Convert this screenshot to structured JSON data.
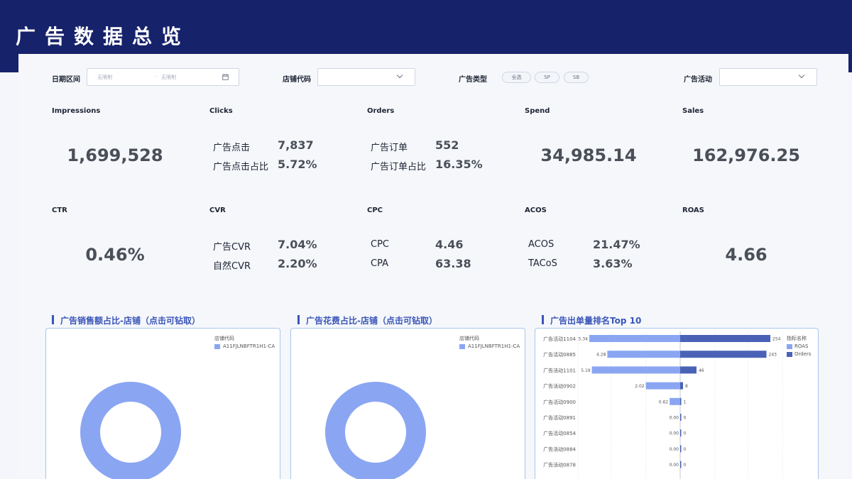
{
  "header": {
    "title": "广告数据总览"
  },
  "filters": {
    "date_label": "日期区间",
    "date_start_placeholder": "无限制",
    "date_end_placeholder": "无限制",
    "date_separator": "-",
    "store_label": "店铺代码",
    "ad_type_label": "广告类型",
    "ad_type_options": [
      "全选",
      "SP",
      "SB"
    ],
    "campaign_label": "广告活动"
  },
  "kpis": {
    "impressions": {
      "title": "Impressions",
      "value": "1,699,528"
    },
    "clicks": {
      "title": "Clicks",
      "rows": [
        {
          "label": "广告点击",
          "value": "7,837"
        },
        {
          "label": "广告点击占比",
          "value": "5.72%"
        }
      ]
    },
    "orders": {
      "title": "Orders",
      "rows": [
        {
          "label": "广告订单",
          "value": "552"
        },
        {
          "label": "广告订单占比",
          "value": "16.35%"
        }
      ]
    },
    "spend": {
      "title": "Spend",
      "value": "34,985.14"
    },
    "sales": {
      "title": "Sales",
      "value": "162,976.25"
    },
    "ctr": {
      "title": "CTR",
      "value": "0.46%"
    },
    "cvr": {
      "title": "CVR",
      "rows": [
        {
          "label": "广告CVR",
          "value": "7.04%"
        },
        {
          "label": "自然CVR",
          "value": "2.20%"
        }
      ]
    },
    "cpc": {
      "title": "CPC",
      "rows": [
        {
          "label": "CPC",
          "value": "4.46"
        },
        {
          "label": "CPA",
          "value": "63.38"
        }
      ]
    },
    "acos": {
      "title": "ACOS",
      "rows": [
        {
          "label": "ACOS",
          "value": "21.47%"
        },
        {
          "label": "TACoS",
          "value": "3.63%"
        }
      ]
    },
    "roas": {
      "title": "ROAS",
      "value": "4.66"
    }
  },
  "sections": {
    "sales_share": {
      "title": "广告销售额占比-店铺（点击可钻取）",
      "legend_title": "店铺代码",
      "legend_item": "A11FJLNBFTR1H1-CA"
    },
    "spend_share": {
      "title": "广告花费占比-店铺（点击可钻取）",
      "legend_title": "店铺代码",
      "legend_item": "A11FJLNBFTR1H1-CA"
    },
    "top10": {
      "title": "广告出单量排名Top 10",
      "legend_title": "指标名称",
      "legend_items": [
        "ROAS",
        "Orders"
      ]
    }
  },
  "colors": {
    "header": "#16226a",
    "roas": "#8aa6f2",
    "orders": "#4a62b6",
    "accent": "#3a55b8"
  },
  "chart_data": [
    {
      "type": "pie",
      "categories": [
        "A11FJLNBFTR1H1-CA"
      ],
      "values": [
        100
      ]
    },
    {
      "type": "pie",
      "categories": [
        "A11FJLNBFTR1H1-CA"
      ],
      "values": [
        100
      ]
    },
    {
      "type": "bar",
      "categories": [
        "广告活动1104",
        "广告活动0885",
        "广告活动1101",
        "广告活动0902",
        "广告活动0900",
        "广告活动0891",
        "广告活动0854",
        "广告活动0884",
        "广告活动0878"
      ],
      "series": [
        {
          "name": "ROAS",
          "values": [
            5.34,
            4.28,
            5.19,
            2.02,
            0.62,
            0.0,
            0.0,
            0.0,
            0.0
          ],
          "labels": [
            "5.34",
            "4.28",
            "5.19",
            "2.02",
            "0.62",
            "0.00",
            "0.00",
            "0.00",
            "0.00"
          ]
        },
        {
          "name": "Orders",
          "values": [
            254,
            243,
            46,
            8,
            1,
            0,
            0,
            0,
            0
          ],
          "labels": [
            "254",
            "243",
            "46",
            "8",
            "1",
            "0",
            "0",
            "0",
            "0"
          ]
        }
      ],
      "title": "广告出单量排名Top 10"
    }
  ]
}
